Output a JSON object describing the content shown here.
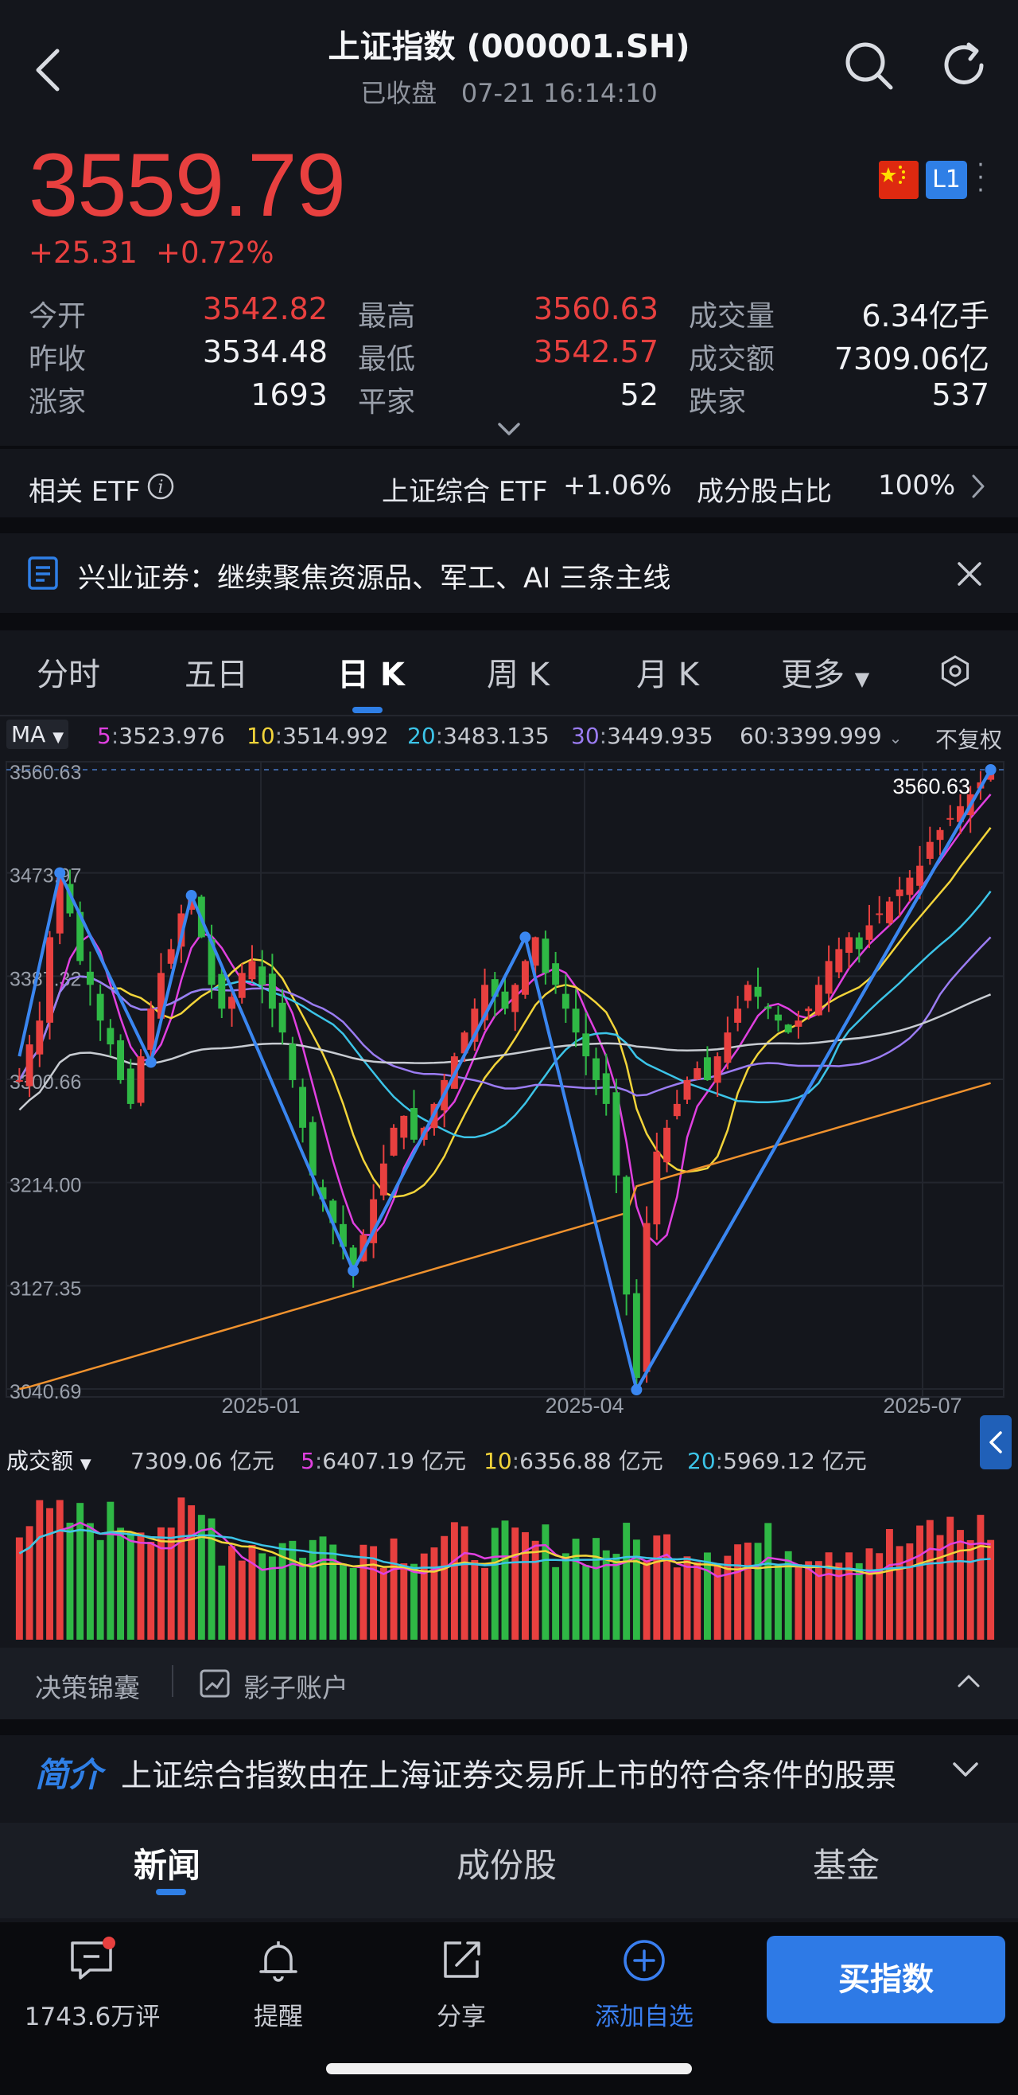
{
  "header": {
    "title": "上证指数 (000001.SH)",
    "status": "已收盘",
    "datetime": "07-21 16:14:10"
  },
  "quote": {
    "price": "3559.79",
    "change": "+25.31",
    "change_pct": "+0.72%",
    "market_level": "L1",
    "stats": [
      {
        "label": "今开",
        "value": "3542.82",
        "color": "#e8403f"
      },
      {
        "label": "最高",
        "value": "3560.63",
        "color": "#e8403f"
      },
      {
        "label": "成交量",
        "value": "6.34亿手",
        "color": "#f1f2f5"
      },
      {
        "label": "昨收",
        "value": "3534.48",
        "color": "#f1f2f5"
      },
      {
        "label": "最低",
        "value": "3542.57",
        "color": "#e8403f"
      },
      {
        "label": "成交额",
        "value": "7309.06亿",
        "color": "#f1f2f5"
      },
      {
        "label": "涨家",
        "value": "1693",
        "color": "#f1f2f5"
      },
      {
        "label": "平家",
        "value": "52",
        "color": "#f1f2f5"
      },
      {
        "label": "跌家",
        "value": "537",
        "color": "#f1f2f5"
      }
    ]
  },
  "etf": {
    "label": "相关 ETF",
    "name": "上证综合 ETF",
    "pct": "+1.06%",
    "component_label": "成分股占比",
    "component_pct": "100%"
  },
  "news_banner": {
    "text": "兴业证券：继续聚焦资源品、军工、AI 三条主线"
  },
  "chart_tabs": [
    "分时",
    "五日",
    "日 K",
    "周 K",
    "月 K",
    "更多"
  ],
  "ma_legend": {
    "selector": "MA",
    "items": [
      {
        "period": "5",
        "value": "3523.976",
        "color": "#e040e0"
      },
      {
        "period": "10",
        "value": "3514.992",
        "color": "#f2d43a"
      },
      {
        "period": "20",
        "value": "3483.135",
        "color": "#3cc4e8"
      },
      {
        "period": "30",
        "value": "3449.935",
        "color": "#9b7cf2"
      },
      {
        "period": "60",
        "value": "3399.999",
        "color": "#c8ccd2"
      }
    ],
    "adjust": "不复权"
  },
  "chart_data": {
    "type": "candlestick",
    "y_ticks": [
      "3560.63",
      "3473.97",
      "3387.32",
      "3300.66",
      "3214.00",
      "3127.35",
      "3040.69"
    ],
    "ylim": [
      3040.69,
      3560.63
    ],
    "x_ticks": [
      "2025-01",
      "2025-04",
      "2025-07"
    ],
    "max_label": "3560.63",
    "pivot_points": [
      {
        "label": "high",
        "value": 3474
      },
      {
        "label": "low",
        "value": 3315
      },
      {
        "label": "high",
        "value": 3455
      },
      {
        "label": "low",
        "value": 3140
      },
      {
        "label": "high",
        "value": 3420
      },
      {
        "label": "low",
        "value": 3040
      },
      {
        "label": "high",
        "value": 3560.63
      }
    ],
    "close_series": [
      3300,
      3330,
      3350,
      3420,
      3470,
      3440,
      3400,
      3380,
      3350,
      3330,
      3300,
      3280,
      3320,
      3360,
      3390,
      3410,
      3440,
      3455,
      3420,
      3380,
      3360,
      3370,
      3390,
      3400,
      3380,
      3360,
      3340,
      3300,
      3260,
      3220,
      3200,
      3180,
      3160,
      3140,
      3170,
      3200,
      3230,
      3260,
      3270,
      3250,
      3260,
      3280,
      3300,
      3320,
      3340,
      3360,
      3380,
      3370,
      3360,
      3380,
      3400,
      3420,
      3390,
      3380,
      3360,
      3340,
      3320,
      3300,
      3280,
      3220,
      3120,
      3050,
      3180,
      3240,
      3260,
      3280,
      3300,
      3310,
      3300,
      3320,
      3340,
      3360,
      3380,
      3370,
      3360,
      3350,
      3340,
      3350,
      3360,
      3380,
      3400,
      3410,
      3420,
      3410,
      3430,
      3440,
      3450,
      3460,
      3470,
      3480,
      3500,
      3510,
      3520,
      3530,
      3540,
      3550,
      3559.79
    ]
  },
  "volume": {
    "selector": "成交额",
    "total": "7309.06 亿元",
    "items": [
      {
        "period": "5",
        "value": "6407.19 亿元",
        "color": "#e040e0"
      },
      {
        "period": "10",
        "value": "6356.88 亿元",
        "color": "#f2d43a"
      },
      {
        "period": "20",
        "value": "5969.12 亿元",
        "color": "#3cc4e8"
      }
    ]
  },
  "tools": {
    "decision": "决策锦囊",
    "shadow": "影子账户"
  },
  "intro": {
    "label": "简介",
    "text": "上证综合指数由在上海证券交易所上市的符合条件的股票"
  },
  "news_tabs": [
    "新闻",
    "成份股",
    "基金"
  ],
  "bottom_bar": {
    "comments": "1743.6万评",
    "alert": "提醒",
    "share": "分享",
    "add_watch": "添加自选",
    "buy": "买指数"
  }
}
